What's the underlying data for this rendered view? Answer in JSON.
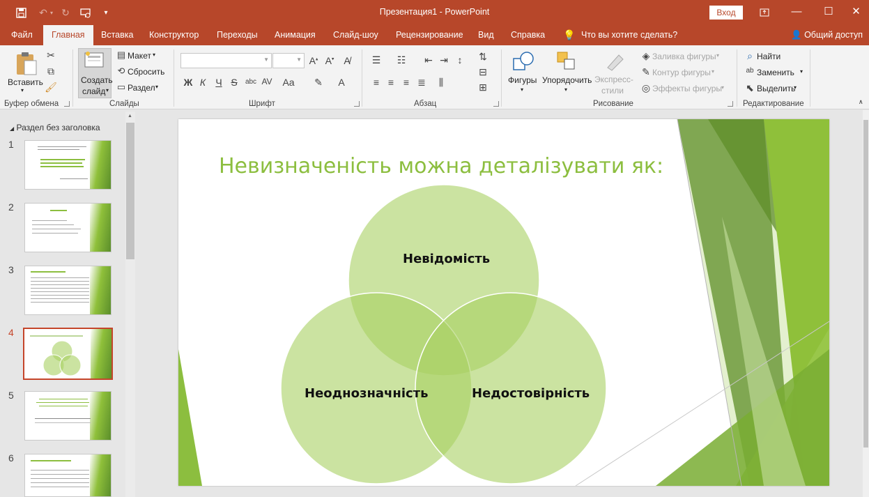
{
  "window": {
    "title": "Презентация1  -  PowerPoint",
    "login_label": "Вход"
  },
  "ribbon_tabs": [
    "Файл",
    "Главная",
    "Вставка",
    "Конструктор",
    "Переходы",
    "Анимация",
    "Слайд-шоу",
    "Рецензирование",
    "Вид",
    "Справка"
  ],
  "tell_me": "Что вы хотите сделать?",
  "share_label": "Общий доступ",
  "groups": {
    "clipboard": {
      "label": "Буфер обмена",
      "paste": "Вставить"
    },
    "slides": {
      "label": "Слайды",
      "new_slide_line1": "Создать",
      "new_slide_line2": "слайд",
      "layout": "Макет",
      "reset": "Сбросить",
      "section": "Раздел"
    },
    "font": {
      "label": "Шрифт",
      "bold": "Ж",
      "italic": "К",
      "underline": "Ч",
      "strike": "S",
      "shadow": "abc",
      "spacing": "AV",
      "case": "Aa"
    },
    "paragraph": {
      "label": "Абзац"
    },
    "drawing": {
      "label": "Рисование",
      "shapes": "Фигуры",
      "arrange": "Упорядочить",
      "quick_styles_line1": "Экспресс-",
      "quick_styles_line2": "стили",
      "fill": "Заливка фигуры",
      "outline": "Контур фигуры",
      "effects": "Эффекты фигуры"
    },
    "editing": {
      "label": "Редактирование",
      "find": "Найти",
      "replace": "Заменить",
      "select": "Выделить"
    }
  },
  "thumbnail_pane": {
    "section_title": "Раздел без заголовка",
    "slide_numbers": [
      "1",
      "2",
      "3",
      "4",
      "5",
      "6"
    ],
    "selected_index": 4
  },
  "slide": {
    "title": "Невизначеність можна деталізувати як:",
    "circles": [
      "Невідомість",
      "Неоднозначність",
      "Недостовірність"
    ]
  },
  "colors": {
    "accent": "#b7472a",
    "title_green": "#8cbe3f",
    "circle_green": "#a9d062"
  }
}
